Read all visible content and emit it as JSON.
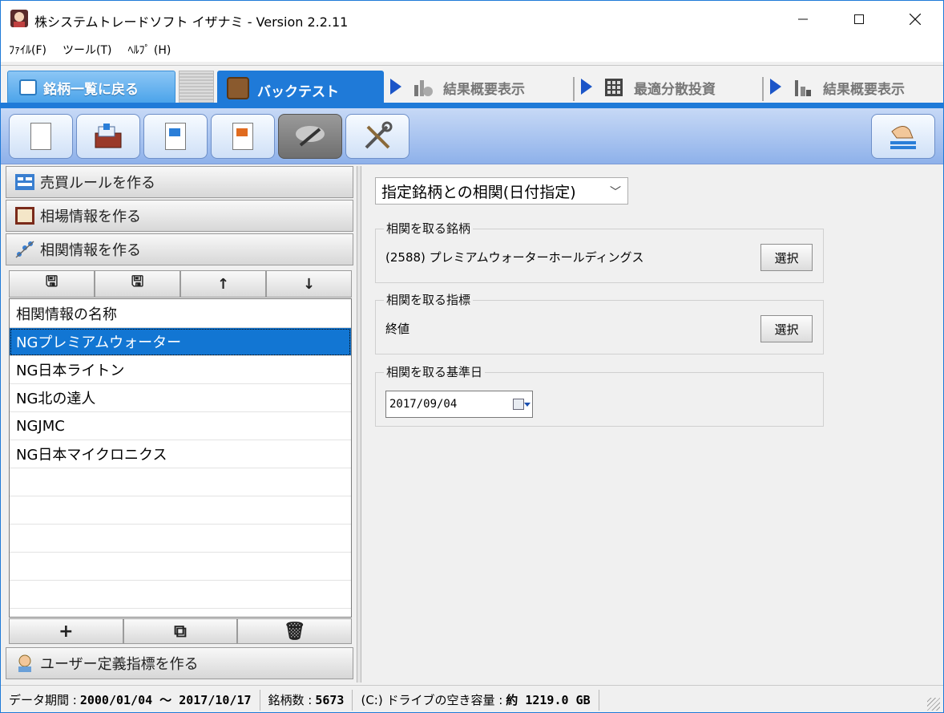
{
  "window": {
    "title": "株システムトレードソフト イザナミ - Version 2.2.11",
    "minimize": "—",
    "maximize": "☐",
    "close": "✕"
  },
  "menu": [
    "ﾌｧｲﾙ(F)",
    "ツール(T)",
    "ﾍﾙﾌﾟ (H)"
  ],
  "tabs": {
    "back": "銘柄一覧に戻る",
    "active": "バックテスト",
    "t3": "結果概要表示",
    "t4": "最適分散投資",
    "t5": "結果概要表示"
  },
  "toolbar": {
    "icons": [
      "new-document-icon",
      "open-chest-icon",
      "export-icon",
      "import-icon",
      "brush-icon",
      "tools-icon",
      "hand-icon"
    ]
  },
  "left": {
    "acc1": "売買ルールを作る",
    "acc2": "相場情報を作る",
    "acc3": "相関情報を作る",
    "acc_bottom": "ユーザー定義指標を作る",
    "list_header": "相関情報の名称",
    "items": [
      "NGプレミアムウォーター",
      "NG日本ライトン",
      "NG北の達人",
      "NGJMC",
      "NG日本マイクロニクス"
    ],
    "selected_index": 0,
    "toolbar_glyphs": [
      "🖫",
      "🖫",
      "↑",
      "↓"
    ],
    "bottom_glyphs": [
      "+",
      "⧉",
      "🗑"
    ]
  },
  "right": {
    "combo_value": "指定銘柄との相関(日付指定)",
    "combo_chevron": "﹀",
    "group1": {
      "title": "相関を取る銘柄",
      "value": "(2588) プレミアムウォーターホールディングス",
      "button": "選択"
    },
    "group2": {
      "title": "相関を取る指標",
      "value": "終値",
      "button": "選択"
    },
    "group3": {
      "title": "相関を取る基準日",
      "date": "2017/09/04"
    }
  },
  "status": {
    "period_label": "データ期間 :",
    "period_value": "2000/01/04 〜 2017/10/17",
    "count_label": "銘柄数 :",
    "count_value": "5673",
    "drive_label": "(C:) ドライブの空き容量 :",
    "drive_value": "約 1219.0 GB"
  },
  "colors": {
    "accent": "#1f7ad8",
    "selection": "#1276d3"
  }
}
